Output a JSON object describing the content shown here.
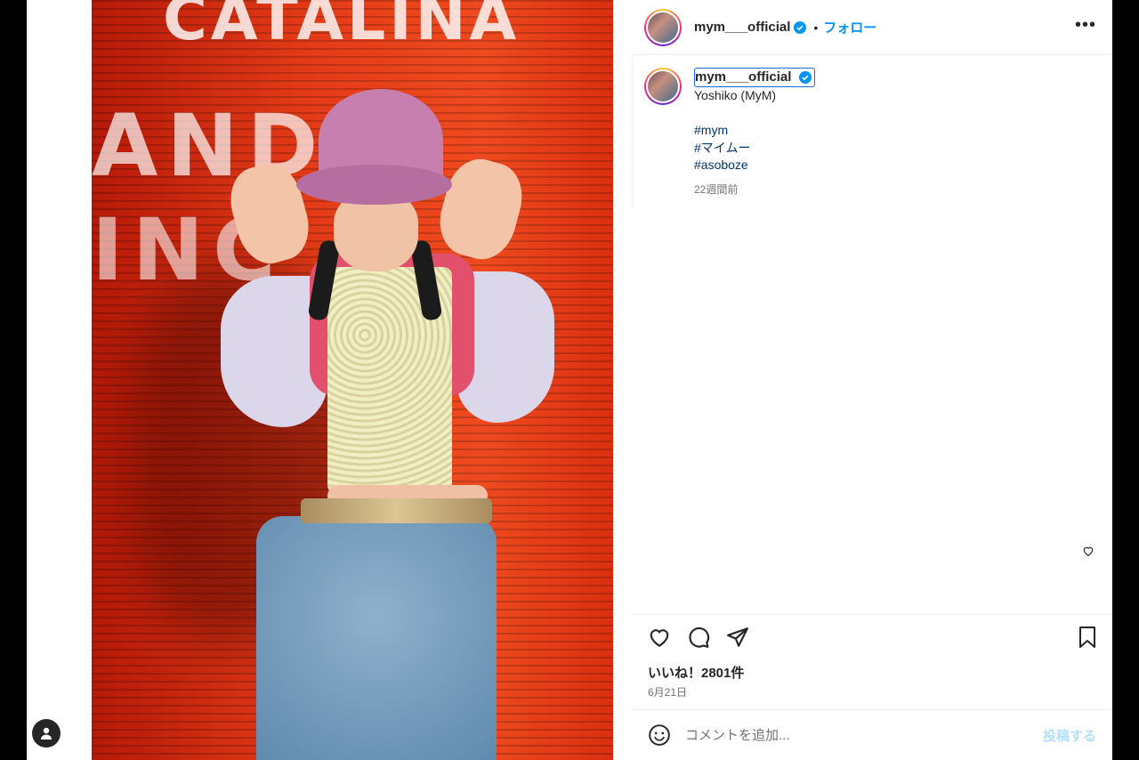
{
  "post": {
    "username": "mym___official",
    "separator": "•",
    "follow_label": "フォロー",
    "more_label": "•••"
  },
  "caption": {
    "username": "mym___official",
    "line1": "Yoshiko (MyM)",
    "hashtags": [
      "#mym",
      "#マイムー",
      "#asoboze"
    ],
    "time_ago": "22週間前"
  },
  "photo": {
    "graffiti": [
      "CATALINA",
      "AND P",
      "INC"
    ]
  },
  "engagement": {
    "likes": "いいね！2801件",
    "date": "6月21日"
  },
  "comment": {
    "placeholder": "コメントを追加...",
    "post_label": "投稿する"
  },
  "colors": {
    "accent": "#0095f6",
    "hashtag": "#00376b",
    "post_disabled": "#b2dffc"
  }
}
